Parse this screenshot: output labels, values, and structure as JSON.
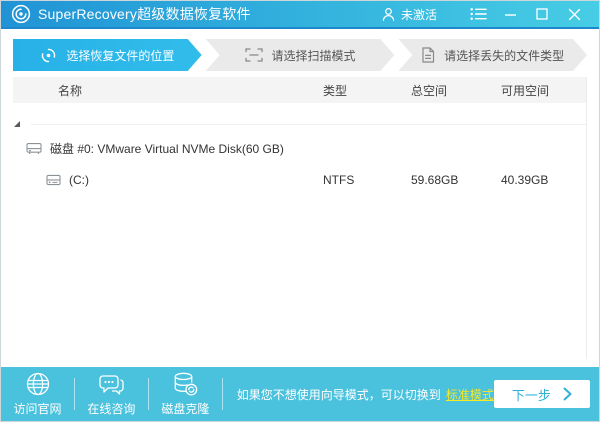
{
  "window": {
    "title": "SuperRecovery超级数据恢复软件",
    "activation_status": "未激活",
    "icons": [
      "logo-swirl-icon",
      "user-icon",
      "menu-list-icon",
      "minimize-icon",
      "maximize-icon",
      "close-icon"
    ]
  },
  "steps": [
    {
      "label": "选择恢复文件的位置",
      "icon": "recovery-location-icon",
      "active": true
    },
    {
      "label": "请选择扫描模式",
      "icon": "scan-mode-icon",
      "active": false
    },
    {
      "label": "请选择丢失的文件类型",
      "icon": "lost-file-type-icon",
      "active": false
    }
  ],
  "table": {
    "columns": [
      "名称",
      "类型",
      "总空间",
      "可用空间"
    ]
  },
  "tree": {
    "disk": {
      "name": "磁盘 #0: VMware Virtual NVMe Disk(60 GB)"
    },
    "partition": {
      "name": "(C:)",
      "type": "NTFS",
      "total": "59.68GB",
      "available": "40.39GB"
    }
  },
  "footer": {
    "quick_links": [
      {
        "label": "访问官网",
        "icon": "globe-icon"
      },
      {
        "label": "在线咨询",
        "icon": "chat-icon"
      },
      {
        "label": "磁盘克隆",
        "icon": "disk-clone-icon"
      }
    ],
    "hint_text": "如果您不想使用向导模式，可以切换到",
    "switch_link": "标准模式",
    "next_button": "下一步"
  },
  "colors": {
    "titlebar_gradient_start": "#2093d5",
    "titlebar_gradient_end": "#47cde5",
    "active_step_cyan": "#2cb6e9",
    "footer_cyan": "#4ac1dd",
    "link_yellow": "#f7e825",
    "accent_cyan": "#2fb0d8"
  }
}
